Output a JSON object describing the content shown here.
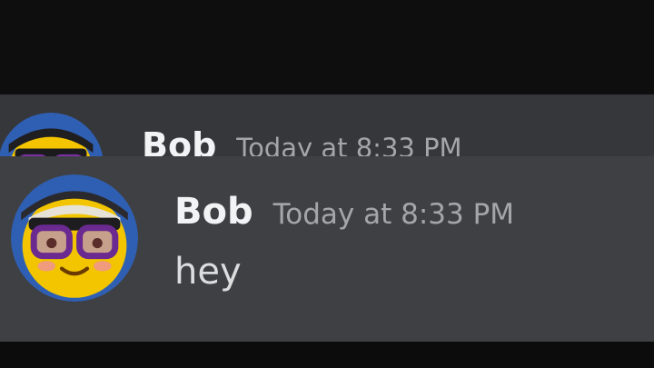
{
  "messages": [
    {
      "author": "Bob",
      "timestamp": "Today at 8:33 PM"
    },
    {
      "author": "Bob",
      "timestamp": "Today at 8:33 PM",
      "content": "hey"
    }
  ],
  "icons": {
    "avatar": "emoji-face-with-glasses-avatar"
  },
  "colors": {
    "background": "#0d0d0e",
    "message_bg": "#3f4043",
    "username": "#f2f3f5",
    "timestamp": "#a3a6aa",
    "text": "#dcddde"
  }
}
